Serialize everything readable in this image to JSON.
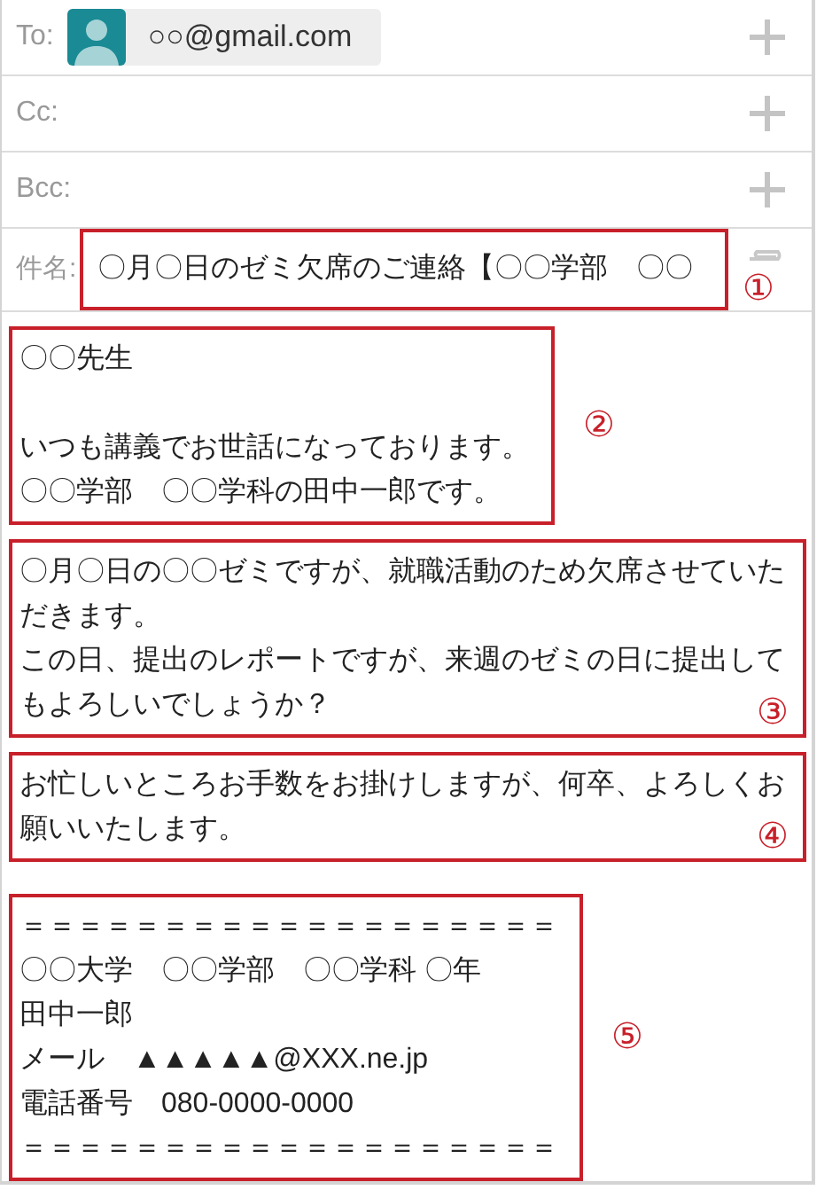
{
  "recipients": [
    {
      "label": "To:",
      "chips": [
        {
          "address": "○○@gmail.com"
        }
      ]
    },
    {
      "label": "Cc:"
    },
    {
      "label": "Bcc:"
    }
  ],
  "subject": {
    "label": "件名:",
    "value": "〇月〇日のゼミ欠席のご連絡【〇〇学部　〇〇",
    "marker": "①"
  },
  "body": [
    {
      "paragraphs": [
        [
          "〇〇先生"
        ],
        [
          "いつも講義でお世話になっております。",
          "〇〇学部　〇〇学科の田中一郎です。"
        ]
      ],
      "marker": "②",
      "kind": "side"
    },
    {
      "paragraphs": [
        [
          "〇月〇日の〇〇ゼミですが、就職活動のため欠席させていた",
          "だきます。",
          "この日、提出のレポートですが、来週のゼミの日に提出して",
          "もよろしいでしょうか？"
        ]
      ],
      "marker": "③",
      "kind": "corner"
    },
    {
      "paragraphs": [
        [
          "お忙しいところお手数をお掛けしますが、何卒、よろしくお",
          "願いいたします。"
        ]
      ],
      "marker": "④",
      "kind": "corner"
    },
    {
      "paragraphs": [
        [
          "＝＝＝＝＝＝＝＝＝＝＝＝＝＝＝＝＝＝＝",
          "〇〇大学　〇〇学部　〇〇学科 〇年",
          "田中一郎",
          "メール　▲▲▲▲▲@XXX.ne.jp",
          "電話番号　080-0000-0000",
          "＝＝＝＝＝＝＝＝＝＝＝＝＝＝＝＝＝＝＝"
        ]
      ],
      "marker": "⑤",
      "kind": "side"
    }
  ]
}
